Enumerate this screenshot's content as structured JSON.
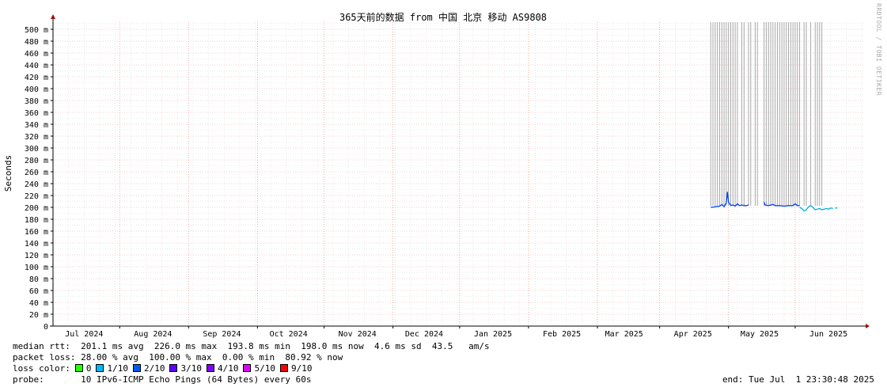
{
  "chart_data": {
    "type": "line",
    "title": "365天前的数据 from 中国 北京 移动 AS9808",
    "ylabel": "Seconds",
    "ylim": [
      0,
      510
    ],
    "y_ticks": [
      {
        "v": 0,
        "label": "0"
      },
      {
        "v": 20,
        "label": "20 m"
      },
      {
        "v": 40,
        "label": "40 m"
      },
      {
        "v": 60,
        "label": "60 m"
      },
      {
        "v": 80,
        "label": "80 m"
      },
      {
        "v": 100,
        "label": "100 m"
      },
      {
        "v": 120,
        "label": "120 m"
      },
      {
        "v": 140,
        "label": "140 m"
      },
      {
        "v": 160,
        "label": "160 m"
      },
      {
        "v": 180,
        "label": "180 m"
      },
      {
        "v": 200,
        "label": "200 m"
      },
      {
        "v": 220,
        "label": "220 m"
      },
      {
        "v": 240,
        "label": "240 m"
      },
      {
        "v": 260,
        "label": "260 m"
      },
      {
        "v": 280,
        "label": "280 m"
      },
      {
        "v": 300,
        "label": "300 m"
      },
      {
        "v": 320,
        "label": "320 m"
      },
      {
        "v": 340,
        "label": "340 m"
      },
      {
        "v": 360,
        "label": "360 m"
      },
      {
        "v": 380,
        "label": "380 m"
      },
      {
        "v": 400,
        "label": "400 m"
      },
      {
        "v": 420,
        "label": "420 m"
      },
      {
        "v": 440,
        "label": "440 m"
      },
      {
        "v": 460,
        "label": "460 m"
      },
      {
        "v": 480,
        "label": "480 m"
      },
      {
        "v": 500,
        "label": "500 m"
      }
    ],
    "x_range_days": [
      0,
      365
    ],
    "x_ticks": [
      {
        "label": "Jul 2024",
        "day": 14
      },
      {
        "label": "Aug 2024",
        "day": 45
      },
      {
        "label": "Sep 2024",
        "day": 76
      },
      {
        "label": "Oct 2024",
        "day": 106
      },
      {
        "label": "Nov 2024",
        "day": 137
      },
      {
        "label": "Dec 2024",
        "day": 167
      },
      {
        "label": "Jan 2025",
        "day": 198
      },
      {
        "label": "Feb 2025",
        "day": 229
      },
      {
        "label": "Mar 2025",
        "day": 257
      },
      {
        "label": "Apr 2025",
        "day": 288
      },
      {
        "label": "May 2025",
        "day": 318
      },
      {
        "label": "Jun 2025",
        "day": 349
      }
    ],
    "month_boundaries_days": [
      30,
      61,
      92,
      122,
      153,
      183,
      214,
      245,
      273,
      304,
      334
    ],
    "loss_spikes_days": [
      296,
      297,
      298,
      299,
      300,
      301,
      302,
      303,
      304,
      305,
      306,
      307,
      308,
      310,
      311,
      313,
      314,
      316,
      317,
      320,
      321,
      322,
      323,
      324,
      325,
      326,
      327,
      328,
      329,
      330,
      331,
      332,
      333,
      334,
      335,
      336,
      338,
      339,
      341,
      343,
      344,
      345,
      346
    ],
    "series": [
      {
        "color": "#0044ff",
        "points": [
          [
            296,
            200
          ],
          [
            298,
            201
          ],
          [
            300,
            202
          ],
          [
            301,
            205
          ],
          [
            302,
            201
          ],
          [
            303,
            208
          ],
          [
            303.5,
            226
          ],
          [
            304,
            209
          ],
          [
            305,
            203
          ],
          [
            306,
            204
          ],
          [
            307,
            202
          ],
          [
            308,
            206
          ],
          [
            309,
            203
          ],
          [
            310,
            204
          ],
          [
            311,
            203
          ],
          [
            312,
            203
          ],
          [
            313,
            204
          ],
          null,
          [
            320,
            209
          ],
          [
            320.5,
            204
          ],
          [
            322,
            203
          ],
          [
            324,
            205
          ],
          [
            325,
            203
          ],
          [
            327,
            203
          ],
          [
            329,
            202
          ],
          [
            331,
            203
          ],
          [
            333,
            203
          ],
          [
            334,
            206
          ],
          [
            335,
            203
          ],
          [
            336,
            203
          ]
        ]
      },
      {
        "color": "#00b0e0",
        "points": [
          [
            336,
            200
          ],
          [
            337,
            198
          ],
          [
            338,
            194
          ],
          [
            339,
            196
          ],
          [
            340,
            201
          ],
          [
            341,
            203
          ],
          [
            342,
            200
          ],
          [
            343,
            196
          ],
          [
            344,
            197
          ],
          [
            345,
            198
          ],
          [
            346,
            196
          ],
          [
            347,
            197
          ],
          [
            348,
            198
          ],
          [
            349,
            197
          ],
          [
            350,
            199
          ],
          [
            351,
            198
          ],
          null,
          [
            352,
            199
          ],
          [
            353,
            199
          ]
        ]
      }
    ]
  },
  "legend": {
    "median_label": "median rtt:",
    "median_values": "201.1 ms avg  226.0 ms max  193.8 ms min  198.0 ms now  4.6 ms sd  43.5   am/s",
    "loss_label": "packet loss:",
    "loss_values": "28.00 % avg  100.00 % max  0.00 % min  80.92 % now",
    "loss_color_label": "loss color:",
    "loss_colors": [
      {
        "label": "0",
        "color": "#26ff00"
      },
      {
        "label": "1/10",
        "color": "#00b8ff"
      },
      {
        "label": "2/10",
        "color": "#0059ff"
      },
      {
        "label": "3/10",
        "color": "#5e00ff"
      },
      {
        "label": "4/10",
        "color": "#7e00ff"
      },
      {
        "label": "5/10",
        "color": "#dd00ff"
      },
      {
        "label": "9/10",
        "color": "#ff0000"
      }
    ],
    "probe_label": "probe:",
    "probe_value": "10 IPv6-ICMP Echo Pings (64 Bytes) every 60s",
    "end_text": "end: Tue Jul  1 23:30:48 2025"
  },
  "watermark": "RRDTOOL / TOBI OETIKER"
}
